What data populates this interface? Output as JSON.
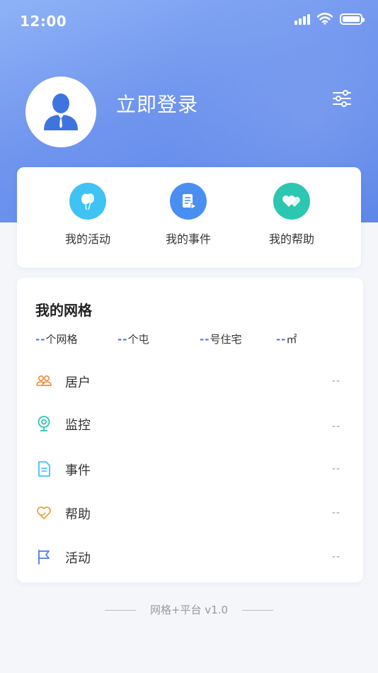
{
  "status_bar": {
    "time": "12:00"
  },
  "profile": {
    "login_label": "立即登录"
  },
  "quick_actions": [
    {
      "label": "我的活动",
      "icon": "balloon-icon",
      "color": "#3fc3f3"
    },
    {
      "label": "我的事件",
      "icon": "document-play-icon",
      "color": "#4a8ef2"
    },
    {
      "label": "我的帮助",
      "icon": "hearts-icon",
      "color": "#2bc7b0"
    }
  ],
  "grid": {
    "title": "我的网格",
    "stats": [
      {
        "value": "--",
        "unit": "个网格"
      },
      {
        "value": "--",
        "unit": "个屯"
      },
      {
        "value": "--",
        "unit": "号住宅"
      },
      {
        "value": "--",
        "unit": "㎡"
      }
    ],
    "rows": [
      {
        "label": "居户",
        "value": "--",
        "icon": "residents-icon",
        "color": "#f08a3c"
      },
      {
        "label": "监控",
        "value": "--",
        "icon": "camera-icon",
        "color": "#2bc7b0"
      },
      {
        "label": "事件",
        "value": "--",
        "icon": "document-icon",
        "color": "#3fc3f3"
      },
      {
        "label": "帮助",
        "value": "--",
        "icon": "heart-hand-icon",
        "color": "#f0a33c"
      },
      {
        "label": "活动",
        "value": "--",
        "icon": "flag-icon",
        "color": "#4a7be8"
      }
    ]
  },
  "footer": {
    "text": "网格+平台 v1.0"
  },
  "colors": {
    "accent": "#5a84e8",
    "header_start": "#8fb2f6"
  }
}
